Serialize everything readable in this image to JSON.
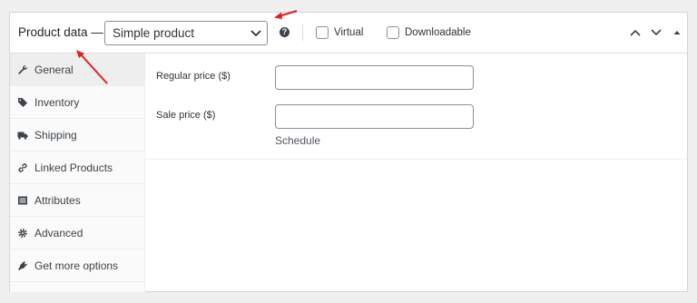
{
  "header": {
    "title": "Product data —",
    "product_type": "Simple product",
    "help_glyph": "?",
    "virtual_label": "Virtual",
    "downloadable_label": "Downloadable"
  },
  "tabs": [
    {
      "label": "General",
      "icon": "wrench-icon",
      "active": true
    },
    {
      "label": "Inventory",
      "icon": "tag-icon",
      "active": false
    },
    {
      "label": "Shipping",
      "icon": "truck-icon",
      "active": false
    },
    {
      "label": "Linked Products",
      "icon": "link-icon",
      "active": false
    },
    {
      "label": "Attributes",
      "icon": "list-icon",
      "active": false
    },
    {
      "label": "Advanced",
      "icon": "gear-icon",
      "active": false
    },
    {
      "label": "Get more options",
      "icon": "plugin-icon",
      "active": false
    }
  ],
  "general": {
    "regular_price_label": "Regular price ($)",
    "regular_price_value": "",
    "sale_price_label": "Sale price ($)",
    "sale_price_value": "",
    "schedule_link": "Schedule"
  },
  "colors": {
    "arrow": "#e02020",
    "link": "#2271b1",
    "active_tab_bg": "#eeeeee"
  }
}
